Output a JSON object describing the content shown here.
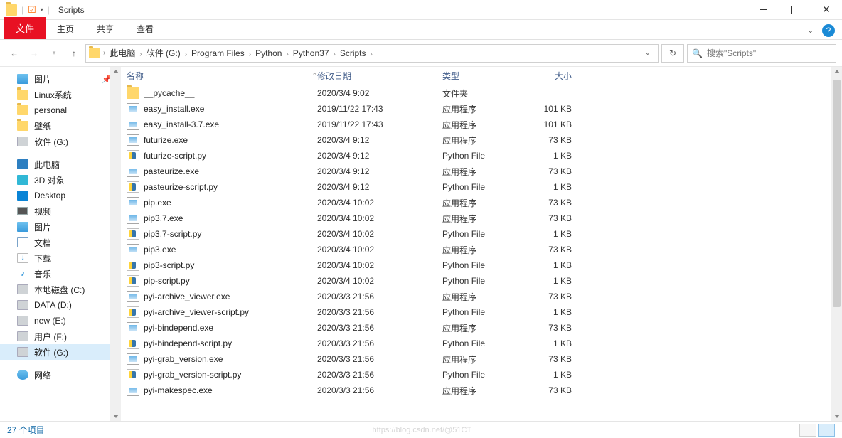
{
  "title": "Scripts",
  "ribbon": {
    "file": "文件",
    "home": "主页",
    "share": "共享",
    "view": "查看"
  },
  "breadcrumbs": [
    "此电脑",
    "软件 (G:)",
    "Program Files",
    "Python",
    "Python37",
    "Scripts"
  ],
  "search": {
    "placeholder": "搜索\"Scripts\""
  },
  "columns": {
    "name": "名称",
    "date": "修改日期",
    "type": "类型",
    "size": "大小"
  },
  "sidebar": [
    {
      "label": "图片",
      "icon": "ico-pic",
      "pinned": true
    },
    {
      "label": "Linux系统",
      "icon": "ico-folder"
    },
    {
      "label": "personal",
      "icon": "ico-folder"
    },
    {
      "label": "壁纸",
      "icon": "ico-folder"
    },
    {
      "label": "软件 (G:)",
      "icon": "ico-drive"
    },
    {
      "spacer": true
    },
    {
      "label": "此电脑",
      "icon": "ico-pc"
    },
    {
      "label": "3D 对象",
      "icon": "ico-3d"
    },
    {
      "label": "Desktop",
      "icon": "ico-desk"
    },
    {
      "label": "视频",
      "icon": "ico-video"
    },
    {
      "label": "图片",
      "icon": "ico-pic"
    },
    {
      "label": "文档",
      "icon": "ico-doc"
    },
    {
      "label": "下载",
      "icon": "ico-down",
      "glyph": "↓"
    },
    {
      "label": "音乐",
      "icon": "ico-music",
      "glyph": "♪"
    },
    {
      "label": "本地磁盘 (C:)",
      "icon": "ico-drive"
    },
    {
      "label": "DATA (D:)",
      "icon": "ico-drive"
    },
    {
      "label": "new (E:)",
      "icon": "ico-drive"
    },
    {
      "label": "用户 (F:)",
      "icon": "ico-drive"
    },
    {
      "label": "软件 (G:)",
      "icon": "ico-drive",
      "selected": true
    },
    {
      "spacer": true
    },
    {
      "label": "网络",
      "icon": "ico-net"
    }
  ],
  "files": [
    {
      "name": "__pycache__",
      "date": "2020/3/4 9:02",
      "type": "文件夹",
      "size": "",
      "icon": "ic-folder"
    },
    {
      "name": "easy_install.exe",
      "date": "2019/11/22 17:43",
      "type": "应用程序",
      "size": "101 KB",
      "icon": "ic-exe"
    },
    {
      "name": "easy_install-3.7.exe",
      "date": "2019/11/22 17:43",
      "type": "应用程序",
      "size": "101 KB",
      "icon": "ic-exe"
    },
    {
      "name": "futurize.exe",
      "date": "2020/3/4 9:12",
      "type": "应用程序",
      "size": "73 KB",
      "icon": "ic-exe"
    },
    {
      "name": "futurize-script.py",
      "date": "2020/3/4 9:12",
      "type": "Python File",
      "size": "1 KB",
      "icon": "ic-py"
    },
    {
      "name": "pasteurize.exe",
      "date": "2020/3/4 9:12",
      "type": "应用程序",
      "size": "73 KB",
      "icon": "ic-exe"
    },
    {
      "name": "pasteurize-script.py",
      "date": "2020/3/4 9:12",
      "type": "Python File",
      "size": "1 KB",
      "icon": "ic-py"
    },
    {
      "name": "pip.exe",
      "date": "2020/3/4 10:02",
      "type": "应用程序",
      "size": "73 KB",
      "icon": "ic-exe"
    },
    {
      "name": "pip3.7.exe",
      "date": "2020/3/4 10:02",
      "type": "应用程序",
      "size": "73 KB",
      "icon": "ic-exe"
    },
    {
      "name": "pip3.7-script.py",
      "date": "2020/3/4 10:02",
      "type": "Python File",
      "size": "1 KB",
      "icon": "ic-py"
    },
    {
      "name": "pip3.exe",
      "date": "2020/3/4 10:02",
      "type": "应用程序",
      "size": "73 KB",
      "icon": "ic-exe"
    },
    {
      "name": "pip3-script.py",
      "date": "2020/3/4 10:02",
      "type": "Python File",
      "size": "1 KB",
      "icon": "ic-py"
    },
    {
      "name": "pip-script.py",
      "date": "2020/3/4 10:02",
      "type": "Python File",
      "size": "1 KB",
      "icon": "ic-py"
    },
    {
      "name": "pyi-archive_viewer.exe",
      "date": "2020/3/3 21:56",
      "type": "应用程序",
      "size": "73 KB",
      "icon": "ic-exe"
    },
    {
      "name": "pyi-archive_viewer-script.py",
      "date": "2020/3/3 21:56",
      "type": "Python File",
      "size": "1 KB",
      "icon": "ic-py"
    },
    {
      "name": "pyi-bindepend.exe",
      "date": "2020/3/3 21:56",
      "type": "应用程序",
      "size": "73 KB",
      "icon": "ic-exe"
    },
    {
      "name": "pyi-bindepend-script.py",
      "date": "2020/3/3 21:56",
      "type": "Python File",
      "size": "1 KB",
      "icon": "ic-py"
    },
    {
      "name": "pyi-grab_version.exe",
      "date": "2020/3/3 21:56",
      "type": "应用程序",
      "size": "73 KB",
      "icon": "ic-exe"
    },
    {
      "name": "pyi-grab_version-script.py",
      "date": "2020/3/3 21:56",
      "type": "Python File",
      "size": "1 KB",
      "icon": "ic-py"
    },
    {
      "name": "pyi-makespec.exe",
      "date": "2020/3/3 21:56",
      "type": "应用程序",
      "size": "73 KB",
      "icon": "ic-exe"
    }
  ],
  "status": "27 个项目",
  "watermark": "https://blog.csdn.net/@51CT"
}
